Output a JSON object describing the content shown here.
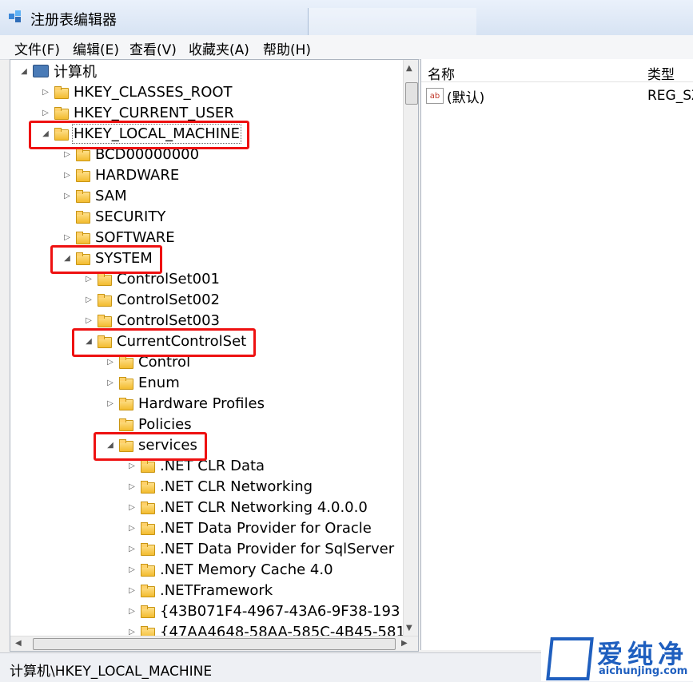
{
  "window": {
    "title": "注册表编辑器"
  },
  "menu": [
    "文件(F)",
    "编辑(E)",
    "查看(V)",
    "收藏夹(A)",
    "帮助(H)"
  ],
  "tree": [
    {
      "label": "计算机",
      "toggle": "◢",
      "level": 0,
      "highlight": false
    },
    {
      "label": "HKEY_CLASSES_ROOT",
      "toggle": "▷",
      "level": 1,
      "highlight": false
    },
    {
      "label": "HKEY_CURRENT_USER",
      "toggle": "▷",
      "level": 1,
      "highlight": false
    },
    {
      "label": "HKEY_LOCAL_MACHINE",
      "toggle": "◢",
      "level": 1,
      "highlight": true,
      "selected": true
    },
    {
      "label": "BCD00000000",
      "toggle": "▷",
      "level": 2,
      "highlight": false
    },
    {
      "label": "HARDWARE",
      "toggle": "▷",
      "level": 2,
      "highlight": false
    },
    {
      "label": "SAM",
      "toggle": "▷",
      "level": 2,
      "highlight": false
    },
    {
      "label": "SECURITY",
      "toggle": "",
      "level": 2,
      "highlight": false
    },
    {
      "label": "SOFTWARE",
      "toggle": "▷",
      "level": 2,
      "highlight": false
    },
    {
      "label": "SYSTEM",
      "toggle": "◢",
      "level": 2,
      "highlight": true
    },
    {
      "label": "ControlSet001",
      "toggle": "▷",
      "level": 3,
      "highlight": false
    },
    {
      "label": "ControlSet002",
      "toggle": "▷",
      "level": 3,
      "highlight": false
    },
    {
      "label": "ControlSet003",
      "toggle": "▷",
      "level": 3,
      "highlight": false
    },
    {
      "label": "CurrentControlSet",
      "toggle": "◢",
      "level": 3,
      "highlight": true
    },
    {
      "label": "Control",
      "toggle": "▷",
      "level": 4,
      "highlight": false
    },
    {
      "label": "Enum",
      "toggle": "▷",
      "level": 4,
      "highlight": false
    },
    {
      "label": "Hardware Profiles",
      "toggle": "▷",
      "level": 4,
      "highlight": false
    },
    {
      "label": "Policies",
      "toggle": "",
      "level": 4,
      "highlight": false
    },
    {
      "label": "services",
      "toggle": "◢",
      "level": 4,
      "highlight": true
    },
    {
      "label": ".NET CLR Data",
      "toggle": "▷",
      "level": 5,
      "highlight": false
    },
    {
      "label": ".NET CLR Networking",
      "toggle": "▷",
      "level": 5,
      "highlight": false
    },
    {
      "label": ".NET CLR Networking 4.0.0.0",
      "toggle": "▷",
      "level": 5,
      "highlight": false
    },
    {
      "label": ".NET Data Provider for Oracle",
      "toggle": "▷",
      "level": 5,
      "highlight": false
    },
    {
      "label": ".NET Data Provider for SqlServer",
      "toggle": "▷",
      "level": 5,
      "highlight": false
    },
    {
      "label": ".NET Memory Cache 4.0",
      "toggle": "▷",
      "level": 5,
      "highlight": false
    },
    {
      "label": ".NETFramework",
      "toggle": "▷",
      "level": 5,
      "highlight": false
    },
    {
      "label": "{43B071F4-4967-43A6-9F38-193",
      "toggle": "▷",
      "level": 5,
      "highlight": false
    },
    {
      "label": "{47AA4648-58AA-585C-4B45-581",
      "toggle": "▷",
      "level": 5,
      "highlight": false
    }
  ],
  "list": {
    "columns": [
      "名称",
      "类型"
    ],
    "rows": [
      {
        "name": "(默认)",
        "type": "REG_SZ"
      }
    ]
  },
  "status": "计算机\\HKEY_LOCAL_MACHINE",
  "watermark": {
    "main": "爱纯净",
    "sub": "aichunjing.com"
  },
  "colors": {
    "highlight": "#e11111",
    "folder": "#f3bb2f",
    "watermark": "#1f5fbf"
  }
}
